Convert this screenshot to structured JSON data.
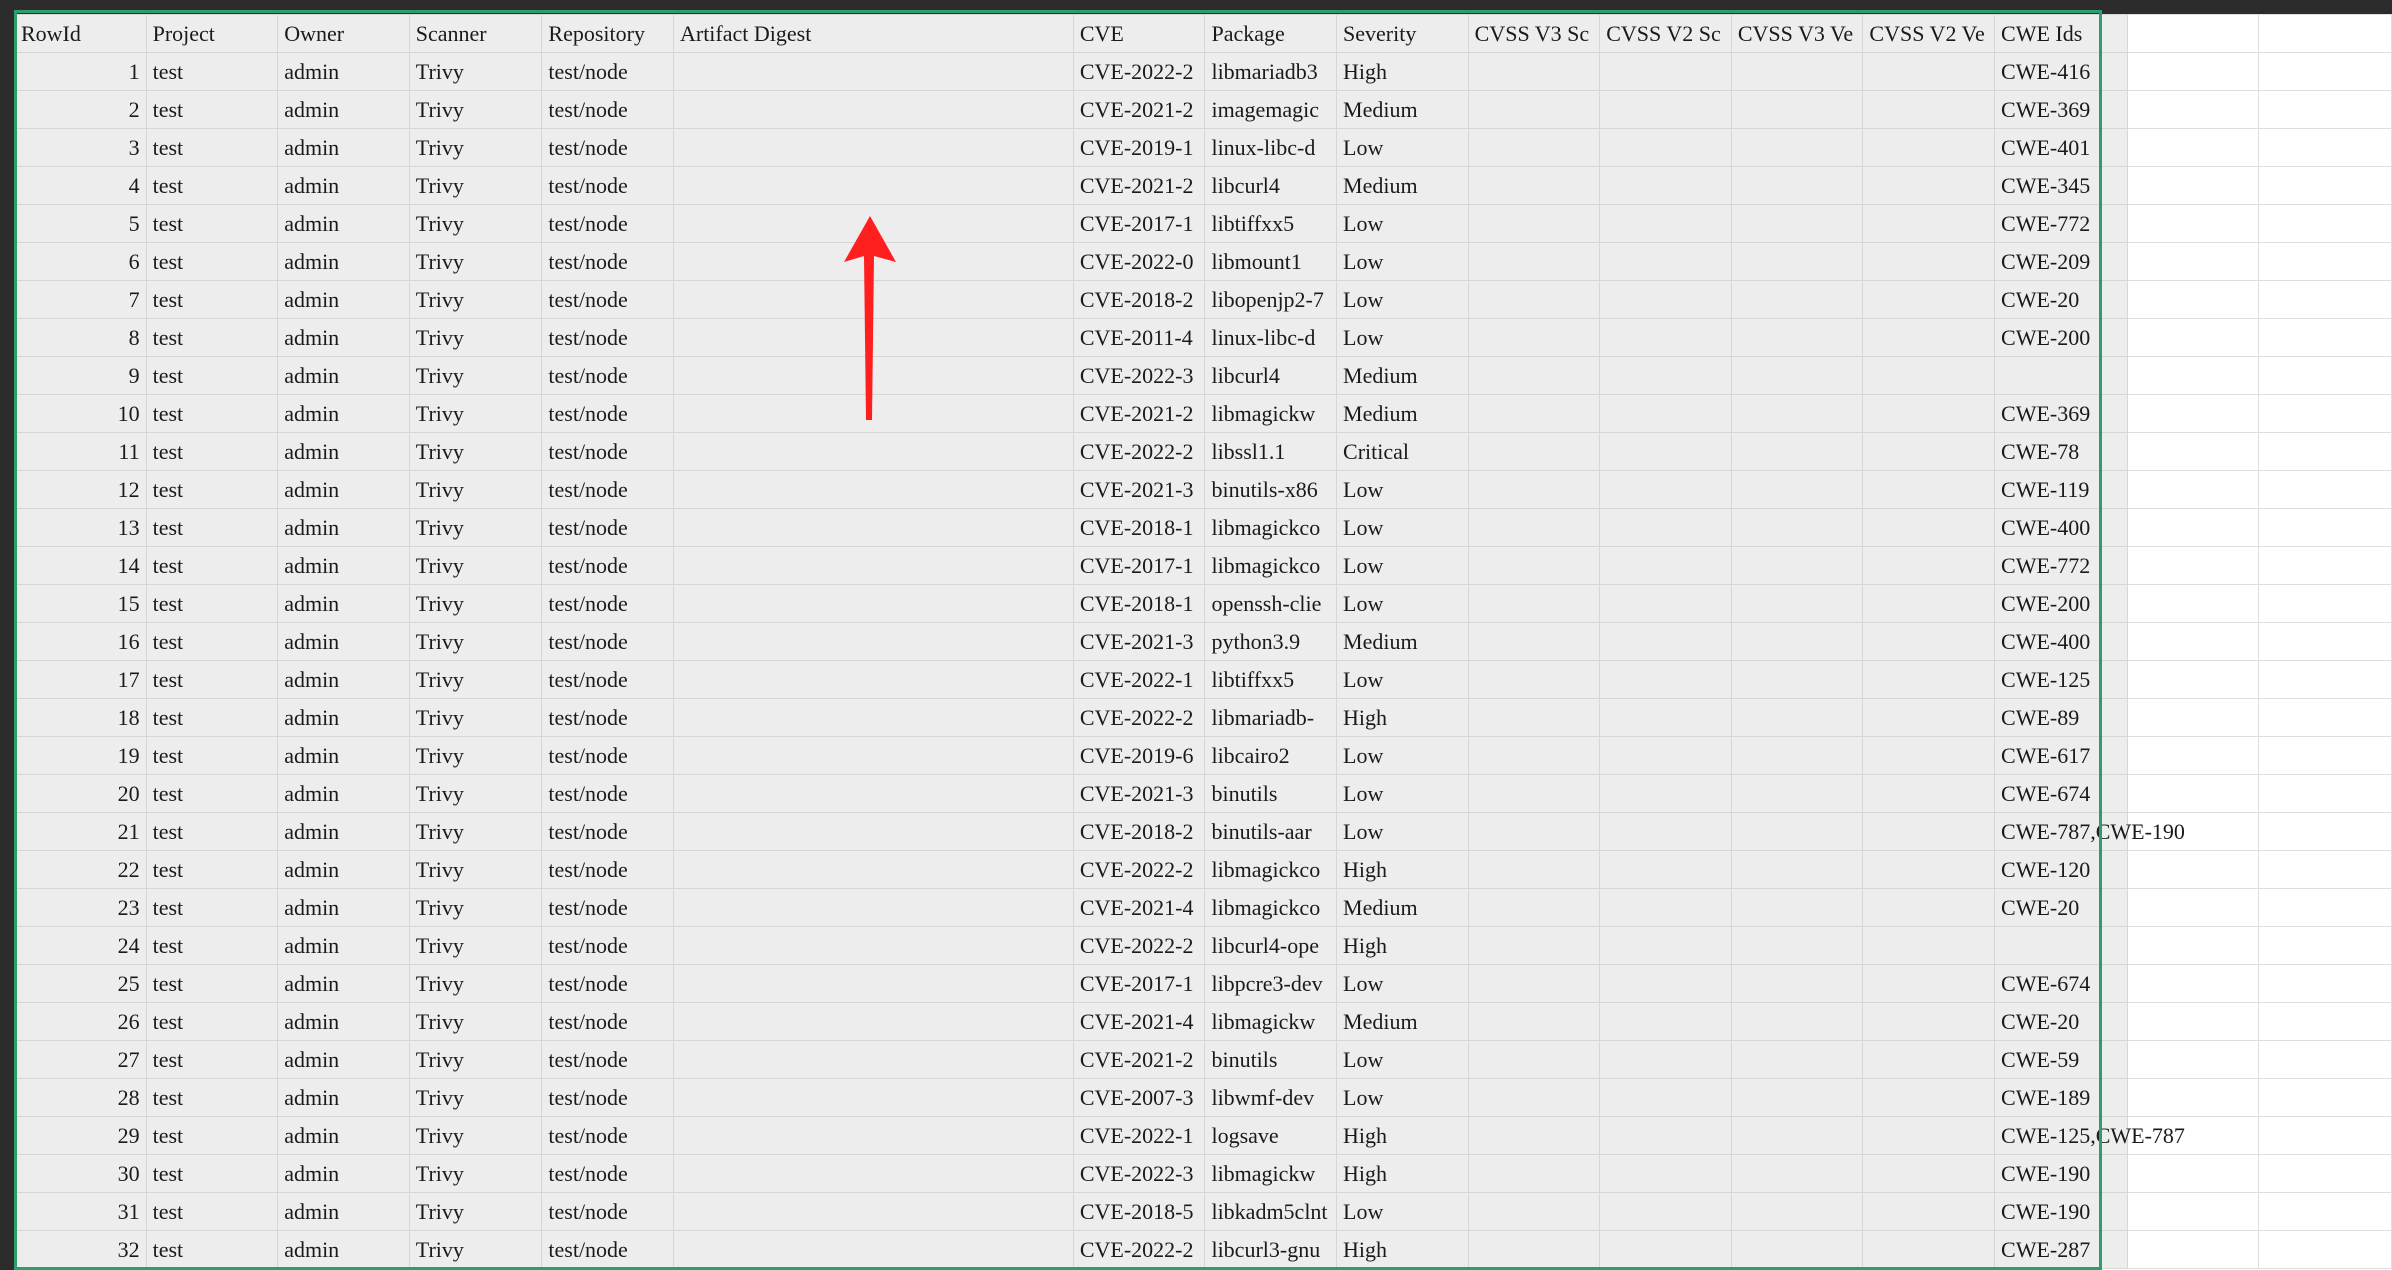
{
  "headers": [
    "RowId",
    "Project",
    "Owner",
    "Scanner",
    "Repository",
    "Artifact Digest",
    "CVE",
    "Package",
    "Severity",
    "CVSS V3 Sc",
    "CVSS V2 Sc",
    "CVSS V3 Ve",
    "CVSS V2 Ve",
    "CWE Ids"
  ],
  "rows": [
    {
      "id": "1",
      "project": "test",
      "owner": "admin",
      "scanner": "Trivy",
      "repository": "test/node",
      "digest": "",
      "cve": "CVE-2022-2",
      "package": "libmariadb3",
      "severity": "High",
      "cwe": "CWE-416"
    },
    {
      "id": "2",
      "project": "test",
      "owner": "admin",
      "scanner": "Trivy",
      "repository": "test/node",
      "digest": "",
      "cve": "CVE-2021-2",
      "package": "imagemagic",
      "severity": "Medium",
      "cwe": "CWE-369"
    },
    {
      "id": "3",
      "project": "test",
      "owner": "admin",
      "scanner": "Trivy",
      "repository": "test/node",
      "digest": "",
      "cve": "CVE-2019-1",
      "package": "linux-libc-d",
      "severity": "Low",
      "cwe": "CWE-401"
    },
    {
      "id": "4",
      "project": "test",
      "owner": "admin",
      "scanner": "Trivy",
      "repository": "test/node",
      "digest": "",
      "cve": "CVE-2021-2",
      "package": "libcurl4",
      "severity": "Medium",
      "cwe": "CWE-345"
    },
    {
      "id": "5",
      "project": "test",
      "owner": "admin",
      "scanner": "Trivy",
      "repository": "test/node",
      "digest": "",
      "cve": "CVE-2017-1",
      "package": "libtiffxx5",
      "severity": "Low",
      "cwe": "CWE-772"
    },
    {
      "id": "6",
      "project": "test",
      "owner": "admin",
      "scanner": "Trivy",
      "repository": "test/node",
      "digest": "",
      "cve": "CVE-2022-0",
      "package": "libmount1",
      "severity": "Low",
      "cwe": "CWE-209"
    },
    {
      "id": "7",
      "project": "test",
      "owner": "admin",
      "scanner": "Trivy",
      "repository": "test/node",
      "digest": "",
      "cve": "CVE-2018-2",
      "package": "libopenjp2-7",
      "severity": "Low",
      "cwe": "CWE-20"
    },
    {
      "id": "8",
      "project": "test",
      "owner": "admin",
      "scanner": "Trivy",
      "repository": "test/node",
      "digest": "",
      "cve": "CVE-2011-4",
      "package": "linux-libc-d",
      "severity": "Low",
      "cwe": "CWE-200"
    },
    {
      "id": "9",
      "project": "test",
      "owner": "admin",
      "scanner": "Trivy",
      "repository": "test/node",
      "digest": "",
      "cve": "CVE-2022-3",
      "package": "libcurl4",
      "severity": "Medium",
      "cwe": ""
    },
    {
      "id": "10",
      "project": "test",
      "owner": "admin",
      "scanner": "Trivy",
      "repository": "test/node",
      "digest": "",
      "cve": "CVE-2021-2",
      "package": "libmagickw",
      "severity": "Medium",
      "cwe": "CWE-369"
    },
    {
      "id": "11",
      "project": "test",
      "owner": "admin",
      "scanner": "Trivy",
      "repository": "test/node",
      "digest": "",
      "cve": "CVE-2022-2",
      "package": "libssl1.1",
      "severity": "Critical",
      "cwe": "CWE-78"
    },
    {
      "id": "12",
      "project": "test",
      "owner": "admin",
      "scanner": "Trivy",
      "repository": "test/node",
      "digest": "",
      "cve": "CVE-2021-3",
      "package": "binutils-x86",
      "severity": "Low",
      "cwe": "CWE-119"
    },
    {
      "id": "13",
      "project": "test",
      "owner": "admin",
      "scanner": "Trivy",
      "repository": "test/node",
      "digest": "",
      "cve": "CVE-2018-1",
      "package": "libmagickco",
      "severity": "Low",
      "cwe": "CWE-400"
    },
    {
      "id": "14",
      "project": "test",
      "owner": "admin",
      "scanner": "Trivy",
      "repository": "test/node",
      "digest": "",
      "cve": "CVE-2017-1",
      "package": "libmagickco",
      "severity": "Low",
      "cwe": "CWE-772"
    },
    {
      "id": "15",
      "project": "test",
      "owner": "admin",
      "scanner": "Trivy",
      "repository": "test/node",
      "digest": "",
      "cve": "CVE-2018-1",
      "package": "openssh-clie",
      "severity": "Low",
      "cwe": "CWE-200"
    },
    {
      "id": "16",
      "project": "test",
      "owner": "admin",
      "scanner": "Trivy",
      "repository": "test/node",
      "digest": "",
      "cve": "CVE-2021-3",
      "package": "python3.9",
      "severity": "Medium",
      "cwe": "CWE-400"
    },
    {
      "id": "17",
      "project": "test",
      "owner": "admin",
      "scanner": "Trivy",
      "repository": "test/node",
      "digest": "",
      "cve": "CVE-2022-1",
      "package": "libtiffxx5",
      "severity": "Low",
      "cwe": "CWE-125"
    },
    {
      "id": "18",
      "project": "test",
      "owner": "admin",
      "scanner": "Trivy",
      "repository": "test/node",
      "digest": "",
      "cve": "CVE-2022-2",
      "package": "libmariadb-",
      "severity": "High",
      "cwe": "CWE-89"
    },
    {
      "id": "19",
      "project": "test",
      "owner": "admin",
      "scanner": "Trivy",
      "repository": "test/node",
      "digest": "",
      "cve": "CVE-2019-6",
      "package": "libcairo2",
      "severity": "Low",
      "cwe": "CWE-617"
    },
    {
      "id": "20",
      "project": "test",
      "owner": "admin",
      "scanner": "Trivy",
      "repository": "test/node",
      "digest": "",
      "cve": "CVE-2021-3",
      "package": "binutils",
      "severity": "Low",
      "cwe": "CWE-674"
    },
    {
      "id": "21",
      "project": "test",
      "owner": "admin",
      "scanner": "Trivy",
      "repository": "test/node",
      "digest": "",
      "cve": "CVE-2018-2",
      "package": "binutils-aar",
      "severity": "Low",
      "cwe": "CWE-787,CWE-190"
    },
    {
      "id": "22",
      "project": "test",
      "owner": "admin",
      "scanner": "Trivy",
      "repository": "test/node",
      "digest": "",
      "cve": "CVE-2022-2",
      "package": "libmagickco",
      "severity": "High",
      "cwe": "CWE-120"
    },
    {
      "id": "23",
      "project": "test",
      "owner": "admin",
      "scanner": "Trivy",
      "repository": "test/node",
      "digest": "",
      "cve": "CVE-2021-4",
      "package": "libmagickco",
      "severity": "Medium",
      "cwe": "CWE-20"
    },
    {
      "id": "24",
      "project": "test",
      "owner": "admin",
      "scanner": "Trivy",
      "repository": "test/node",
      "digest": "",
      "cve": "CVE-2022-2",
      "package": "libcurl4-ope",
      "severity": "High",
      "cwe": ""
    },
    {
      "id": "25",
      "project": "test",
      "owner": "admin",
      "scanner": "Trivy",
      "repository": "test/node",
      "digest": "",
      "cve": "CVE-2017-1",
      "package": "libpcre3-dev",
      "severity": "Low",
      "cwe": "CWE-674"
    },
    {
      "id": "26",
      "project": "test",
      "owner": "admin",
      "scanner": "Trivy",
      "repository": "test/node",
      "digest": "",
      "cve": "CVE-2021-4",
      "package": "libmagickw",
      "severity": "Medium",
      "cwe": "CWE-20"
    },
    {
      "id": "27",
      "project": "test",
      "owner": "admin",
      "scanner": "Trivy",
      "repository": "test/node",
      "digest": "",
      "cve": "CVE-2021-2",
      "package": "binutils",
      "severity": "Low",
      "cwe": "CWE-59"
    },
    {
      "id": "28",
      "project": "test",
      "owner": "admin",
      "scanner": "Trivy",
      "repository": "test/node",
      "digest": "",
      "cve": "CVE-2007-3",
      "package": "libwmf-dev",
      "severity": "Low",
      "cwe": "CWE-189"
    },
    {
      "id": "29",
      "project": "test",
      "owner": "admin",
      "scanner": "Trivy",
      "repository": "test/node",
      "digest": "",
      "cve": "CVE-2022-1",
      "package": "logsave",
      "severity": "High",
      "cwe": "CWE-125,CWE-787"
    },
    {
      "id": "30",
      "project": "test",
      "owner": "admin",
      "scanner": "Trivy",
      "repository": "test/node",
      "digest": "",
      "cve": "CVE-2022-3",
      "package": "libmagickw",
      "severity": "High",
      "cwe": "CWE-190"
    },
    {
      "id": "31",
      "project": "test",
      "owner": "admin",
      "scanner": "Trivy",
      "repository": "test/node",
      "digest": "",
      "cve": "CVE-2018-5",
      "package": "libkadm5clnt",
      "severity": "Low",
      "cwe": "CWE-190"
    },
    {
      "id": "32",
      "project": "test",
      "owner": "admin",
      "scanner": "Trivy",
      "repository": "test/node",
      "digest": "",
      "cve": "CVE-2022-2",
      "package": "libcurl3-gnu",
      "severity": "High",
      "cwe": "CWE-287"
    }
  ],
  "colors": {
    "selection_border": "#2e9e6c",
    "cell_fill": "#ededed",
    "annotation_arrow": "#ff1f1f"
  },
  "icons": {
    "annotation": "up-arrow-icon"
  }
}
